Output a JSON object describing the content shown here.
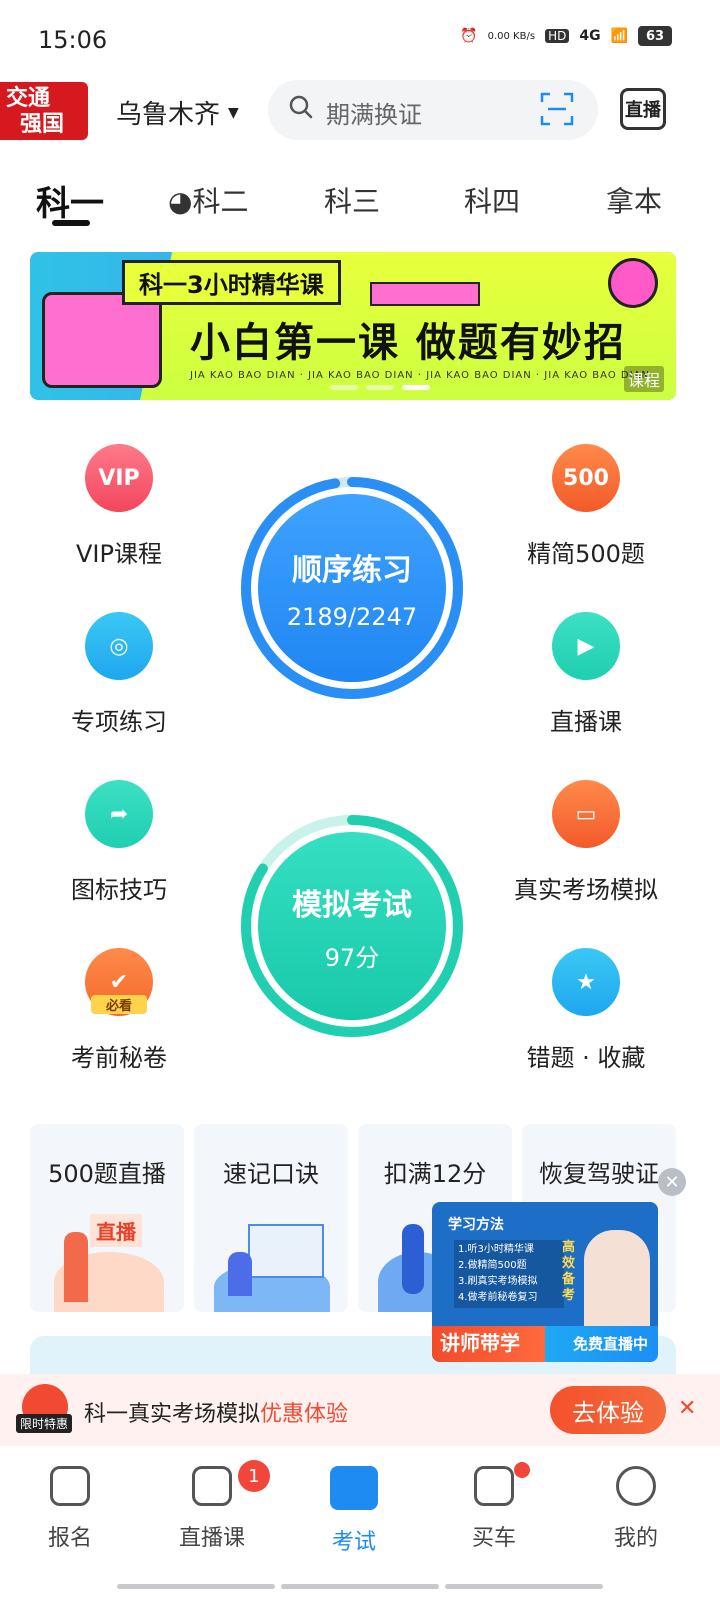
{
  "status": {
    "time": "15:06",
    "net_speed": "0.00 KB/s",
    "hd": "HD",
    "signal": "4G",
    "battery": "63"
  },
  "header": {
    "logo_line1": "交通",
    "logo_line2": "强国",
    "city": "乌鲁木齐",
    "search_placeholder": "期满换证",
    "live_label": "直播"
  },
  "tabs": [
    {
      "label": "科一"
    },
    {
      "label": "科二"
    },
    {
      "label": "科三"
    },
    {
      "label": "科四"
    },
    {
      "label": "拿本"
    }
  ],
  "banner": {
    "tag": "科一3小时精华课",
    "title": "小白第一课 做题有妙招",
    "strip": "JIA KAO BAO DIAN · JIA KAO BAO DIAN · JIA KAO BAO DIAN · JIA KAO BAO DIAN",
    "badge": "课程"
  },
  "functions": {
    "vip": "VIP课程",
    "jingjian": "精简500题",
    "jingjian_icon_text": "500",
    "zhuanxiang": "专项练习",
    "zhibo": "直播课",
    "tubiao": "图标技巧",
    "zhenshi": "真实考场模拟",
    "kaoqian": "考前秘卷",
    "kaoqian_tag": "必看",
    "cuoti": "错题 · 收藏"
  },
  "practice": {
    "title": "顺序练习",
    "progress": "2189/2247",
    "done": 2189,
    "total": 2247
  },
  "mock": {
    "title": "模拟考试",
    "score": "97分"
  },
  "cards": [
    {
      "title": "500题直播",
      "art_text": "直播"
    },
    {
      "title": "速记口诀"
    },
    {
      "title": "扣满12分"
    },
    {
      "title": "恢复驾驶证"
    }
  ],
  "floating_live": {
    "title": "学习方法",
    "steps": [
      "1.听3小时精华课",
      "2.做精简500题",
      "3.刷真实考场模拟",
      "4.做考前秘卷复习"
    ],
    "side": "高效备考",
    "bottom_left": "讲师带学",
    "bottom_right": "免费直播中"
  },
  "promo": {
    "tag": "限时特惠",
    "text": "科一真实考场模拟",
    "highlight": "优惠体验",
    "button": "去体验"
  },
  "bottom_nav": [
    {
      "label": "报名"
    },
    {
      "label": "直播课",
      "badge": "1"
    },
    {
      "label": "考试"
    },
    {
      "label": "买车"
    },
    {
      "label": "我的"
    }
  ],
  "colors": {
    "accent_blue": "#1e8bf0",
    "accent_green": "#1fcfb0",
    "accent_red": "#f24a32"
  }
}
